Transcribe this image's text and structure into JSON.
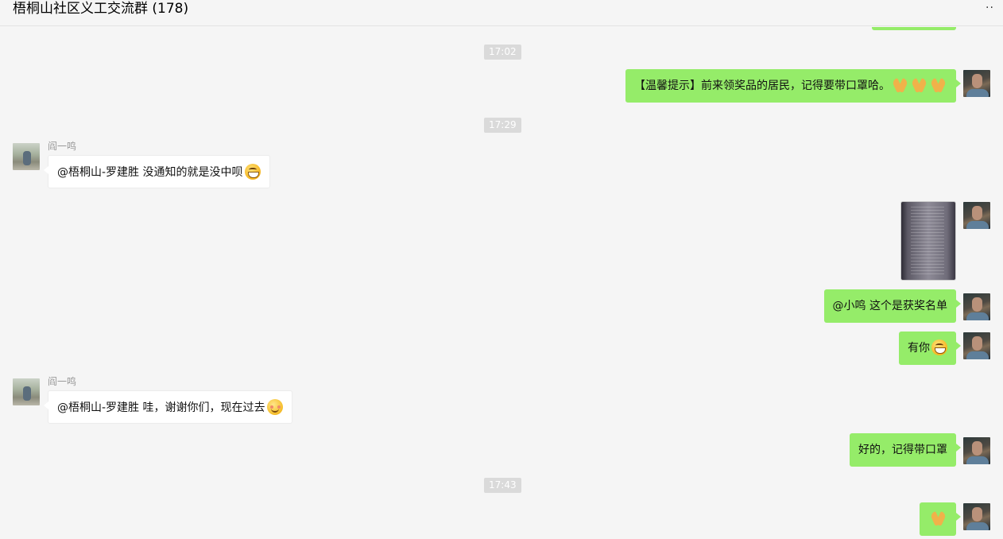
{
  "header": {
    "title": "梧桐山社区义工交流群 (178)",
    "more_icon": "more-dots-icon"
  },
  "timestamps": [
    "17:02",
    "17:29",
    "17:43"
  ],
  "messages": [
    {
      "id": "m1",
      "from": "self",
      "text": "【温馨提示】前来领奖品的居民，记得要带口罩哈。",
      "emojis": [
        "folded-hands",
        "folded-hands",
        "folded-hands"
      ]
    },
    {
      "id": "m2",
      "from": "other",
      "sender": "阎一鸣",
      "text": "@梧桐山-罗建胜 没通知的就是没中呗",
      "emojis": [
        "grin"
      ]
    },
    {
      "id": "m3",
      "from": "self",
      "type": "image",
      "alt": "获奖名单图片"
    },
    {
      "id": "m4",
      "from": "self",
      "text": "@小鸣 这个是获奖名单"
    },
    {
      "id": "m5",
      "from": "self",
      "text": "有你",
      "emojis": [
        "grin"
      ]
    },
    {
      "id": "m6",
      "from": "other",
      "sender": "阎一鸣",
      "text": "@梧桐山-罗建胜 哇，谢谢你们，现在过去",
      "emojis": [
        "smile"
      ]
    },
    {
      "id": "m7",
      "from": "self",
      "text": "好的，记得带口罩"
    },
    {
      "id": "m8",
      "from": "self",
      "text": "",
      "emojis": [
        "folded-hands"
      ]
    }
  ],
  "colors": {
    "self_bubble": "#95ec69",
    "other_bubble": "#ffffff",
    "background": "#f5f5f5",
    "time_pill": "#dadada"
  }
}
